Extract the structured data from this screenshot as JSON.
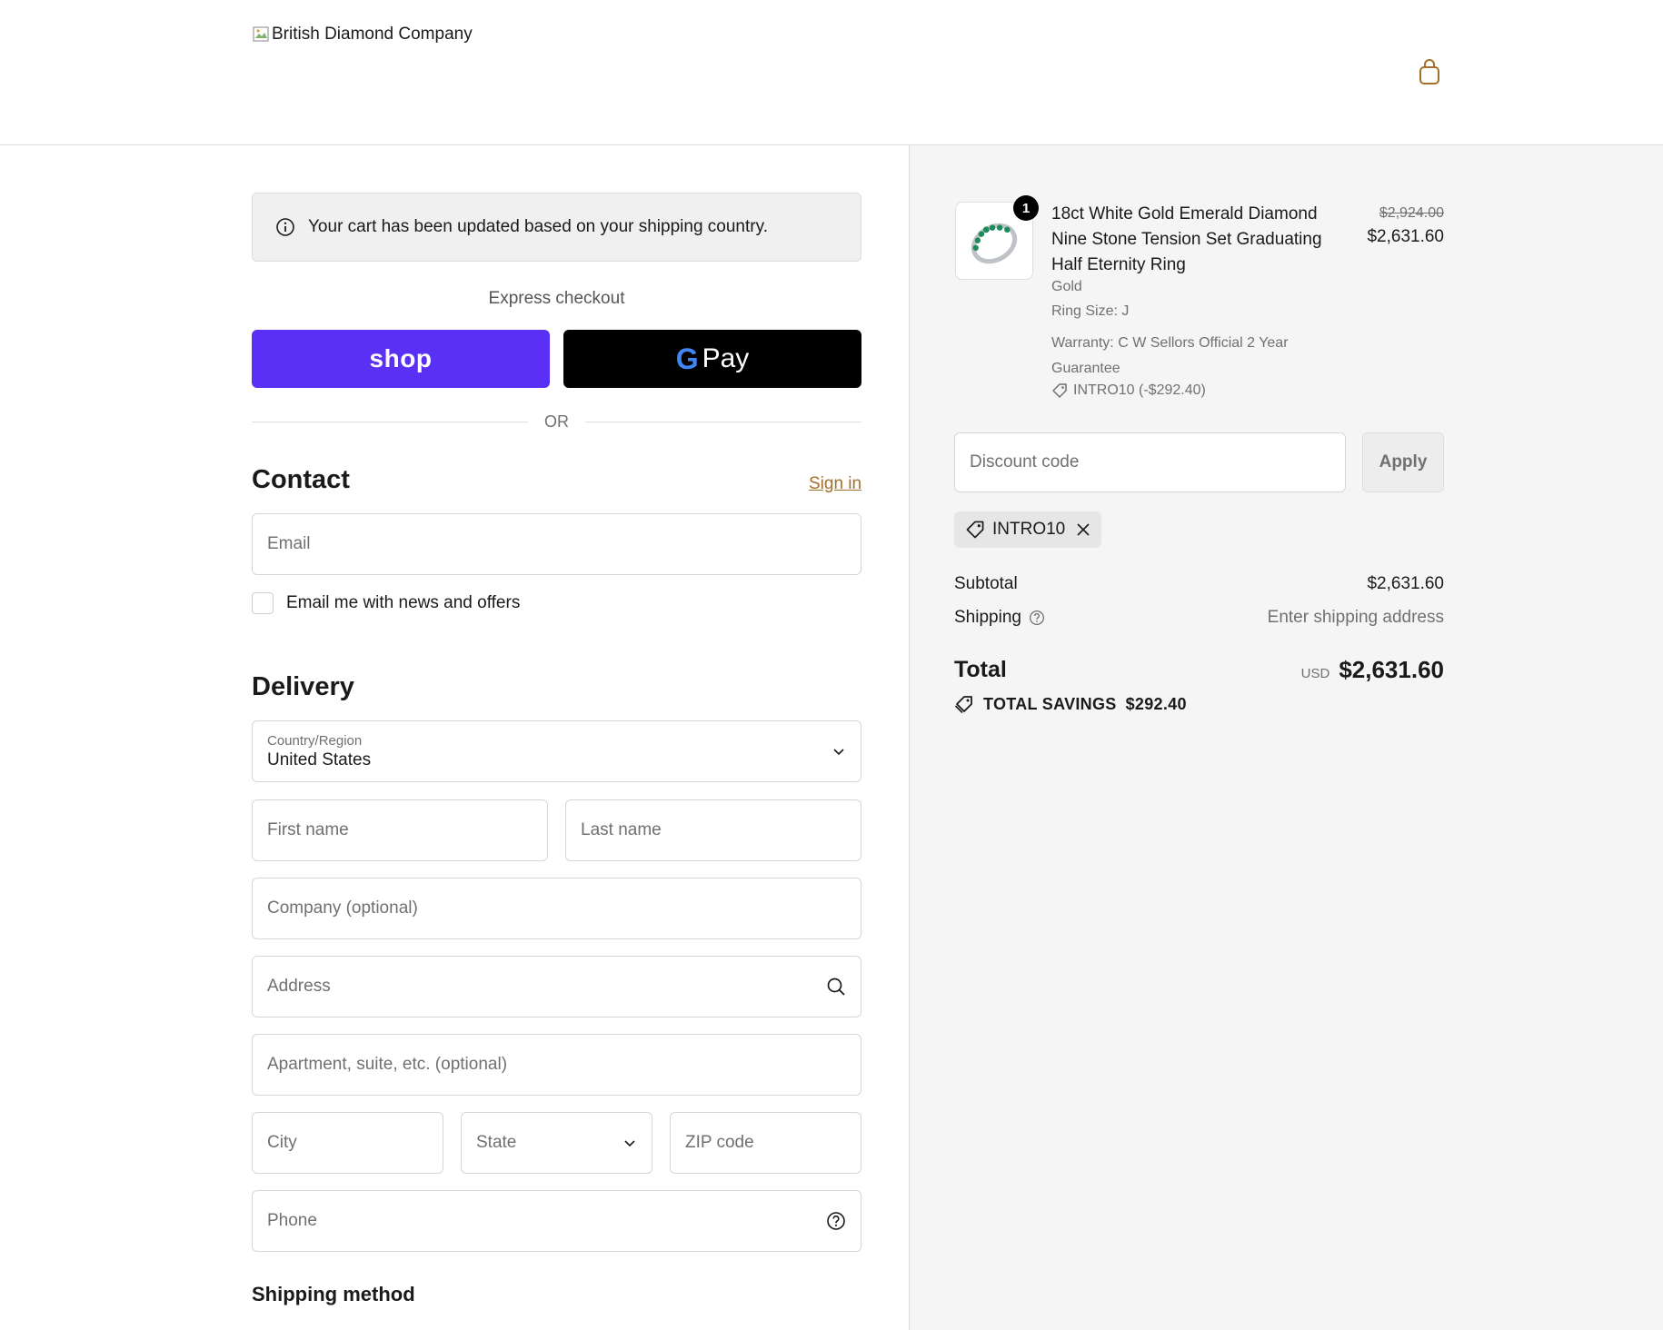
{
  "header": {
    "logo_alt": "British Diamond Company",
    "cart_icon": "shopping-bag-icon"
  },
  "notice": {
    "icon": "info-icon",
    "text": "Your cart has been updated based on your shipping country."
  },
  "express": {
    "label": "Express checkout",
    "shop_label": "shop",
    "gpay_g": "G",
    "gpay_label": "Pay",
    "or_label": "OR"
  },
  "contact": {
    "title": "Contact",
    "signin_label": "Sign in",
    "email_placeholder": "Email",
    "newsletter_label": "Email me with news and offers",
    "newsletter_checked": false
  },
  "delivery": {
    "title": "Delivery",
    "country_label": "Country/Region",
    "country_value": "United States",
    "first_name_placeholder": "First name",
    "last_name_placeholder": "Last name",
    "company_placeholder": "Company (optional)",
    "address_placeholder": "Address",
    "apartment_placeholder": "Apartment, suite, etc. (optional)",
    "city_placeholder": "City",
    "state_placeholder": "State",
    "zip_placeholder": "ZIP code",
    "phone_placeholder": "Phone"
  },
  "shipping_method": {
    "title": "Shipping method"
  },
  "summary": {
    "item": {
      "quantity": "1",
      "title": "18ct White Gold Emerald Diamond Nine Stone Tension Set Graduating Half Eternity Ring",
      "variant": "Gold",
      "ring_size": "Ring Size: J",
      "warranty_line1": "Warranty: C W Sellors Official 2 Year",
      "warranty_line2": "Guarantee",
      "discount_line": "INTRO10 (-$292.40)",
      "price_original": "$2,924.00",
      "price_current": "$2,631.60"
    },
    "discount_placeholder": "Discount code",
    "apply_label": "Apply",
    "applied_code": "INTRO10",
    "subtotal_label": "Subtotal",
    "subtotal_value": "$2,631.60",
    "shipping_label": "Shipping",
    "shipping_value": "Enter shipping address",
    "total_label": "Total",
    "total_currency": "USD",
    "total_value": "$2,631.60",
    "savings_label": "TOTAL SAVINGS",
    "savings_value": "$292.40"
  },
  "colors": {
    "shop_pay": "#5a31f4",
    "gpay": "#000000",
    "signin_link": "#a3702a"
  }
}
